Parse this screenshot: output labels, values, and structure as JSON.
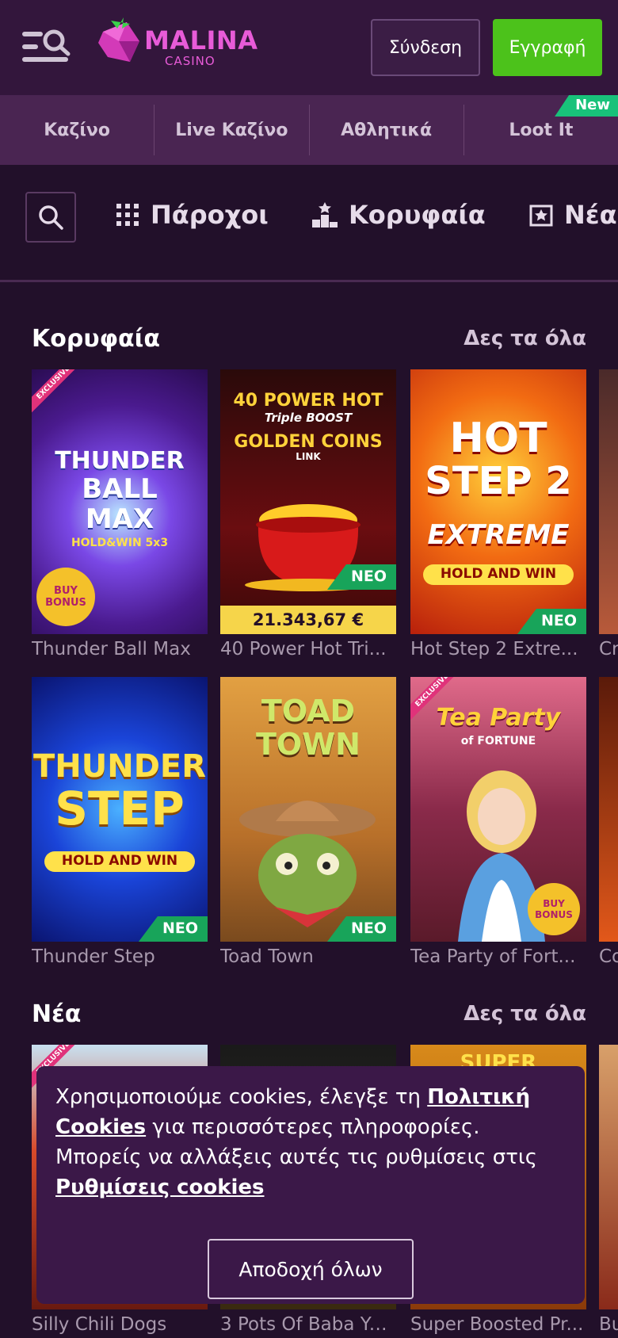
{
  "header": {
    "logo_text": "MALINA",
    "logo_sub": "CASINO",
    "login_label": "Σύνδεση",
    "register_label": "Εγγραφή"
  },
  "nav": {
    "items": [
      {
        "label": "Καζίνο"
      },
      {
        "label": "Live Καζίνο"
      },
      {
        "label": "Αθλητικά"
      },
      {
        "label": "Loot It",
        "badge": "New"
      }
    ]
  },
  "filters": {
    "providers": "Πάροχοι",
    "top": "Κορυφαία",
    "new": "Νέα"
  },
  "top_section": {
    "title": "Κορυφαία",
    "see_all": "Δες τα όλα",
    "games": [
      {
        "name": "Thunder Ball Max",
        "art_lines": [
          "THUNDER",
          "BALL",
          "MAX",
          "HOLD&WIN 5x3"
        ],
        "exclusive": "EXCLUSIVE",
        "buy_bonus": "BUY BONUS"
      },
      {
        "name": "40 Power Hot Tri...",
        "art_lines": [
          "40 POWER HOT",
          "Triple BOOST",
          "GOLDEN COINS",
          "LINK"
        ],
        "badge": "ΝΕΟ",
        "jackpot": "21.343,67 €"
      },
      {
        "name": "Hot Step 2 Extre...",
        "art_lines": [
          "HOT",
          "STEP 2",
          "EXTREME",
          "HOLD AND WIN"
        ],
        "badge": "ΝΕΟ"
      },
      {
        "name": "Cr"
      },
      {
        "name": "Thunder Step",
        "art_lines": [
          "THUNDER",
          "STEP",
          "HOLD AND WIN"
        ],
        "badge": "ΝΕΟ"
      },
      {
        "name": "Toad Town",
        "art_lines": [
          "TOAD",
          "TOWN"
        ],
        "badge": "ΝΕΟ"
      },
      {
        "name": "Tea Party of Fort...",
        "art_lines": [
          "Tea Party",
          "of FORTUNE"
        ],
        "exclusive": "EXCLUSIVE",
        "buy_bonus": "BUY BONUS"
      },
      {
        "name": "Co"
      }
    ]
  },
  "new_section": {
    "title": "Νέα",
    "see_all": "Δες τα όλα",
    "games": [
      {
        "name": "Silly Chili Dogs",
        "exclusive": "EXCLUSIVE"
      },
      {
        "name": "3 Pots Of Baba Ya..."
      },
      {
        "name": "Super Boosted Pr...",
        "art_lines": [
          "SUPER"
        ]
      },
      {
        "name": "Bu"
      }
    ]
  },
  "cookie": {
    "text_1": "Χρησιμοποιούμε cookies, έλεγξε τη",
    "link_policy": "Πολιτική Cookies",
    "text_2": " για περισσότερες πληροφορίες. Μπορείς να αλλάξεις αυτές τις ρυθμίσεις στις ",
    "link_settings": "Ρυθμίσεις cookies",
    "accept_label": "Αποδοχή όλων"
  },
  "colors": {
    "background": "#22102a",
    "header": "#33163c",
    "nav": "#4a2552",
    "register": "#4cc21b",
    "neo_badge": "#18a45a",
    "new_badge": "#18c27a",
    "jackpot": "#f6d54a"
  }
}
